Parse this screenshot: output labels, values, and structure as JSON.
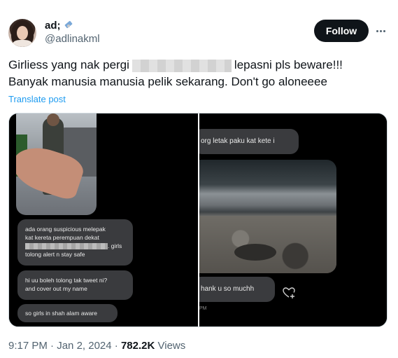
{
  "author": {
    "display_name": "ad;",
    "handle": "@adlinakml",
    "avatar_icon": "avatar",
    "name_emoji_icon": "satellite-icon"
  },
  "follow_label": "Follow",
  "tweet": {
    "line1_before": "Girliess yang nak pergi",
    "line1_after": "lepasni pls beware!!!",
    "line2": "Banyak manusia manusia pelik sekarang. Don't go aloneeee"
  },
  "translate_label": "Translate post",
  "media": {
    "left_chat": {
      "bubble1_line1": "ada orang suspicious melepak",
      "bubble1_line2": "kat kereta perempuan dekat",
      "bubble1_line3_tail": ". girls",
      "bubble1_line4": "tolong alert n stay safe",
      "bubble2_line1": "hi uu boleh tolong tak tweet ni?",
      "bubble2_line2": "and cover out my name",
      "bubble3": "so girls in shah alam aware"
    },
    "right_chat": {
      "bubble1": "org letak paku kat kete i",
      "bubble2": "hank u so muchh",
      "timestamp_fragment": "PM"
    }
  },
  "meta": {
    "time": "9:17 PM",
    "sep": "·",
    "date": "Jan 2, 2024",
    "views_count": "782.2K",
    "views_label": "Views"
  },
  "colors": {
    "link": "#1d9bf0",
    "button_bg": "#0f1419",
    "muted": "#536471"
  }
}
